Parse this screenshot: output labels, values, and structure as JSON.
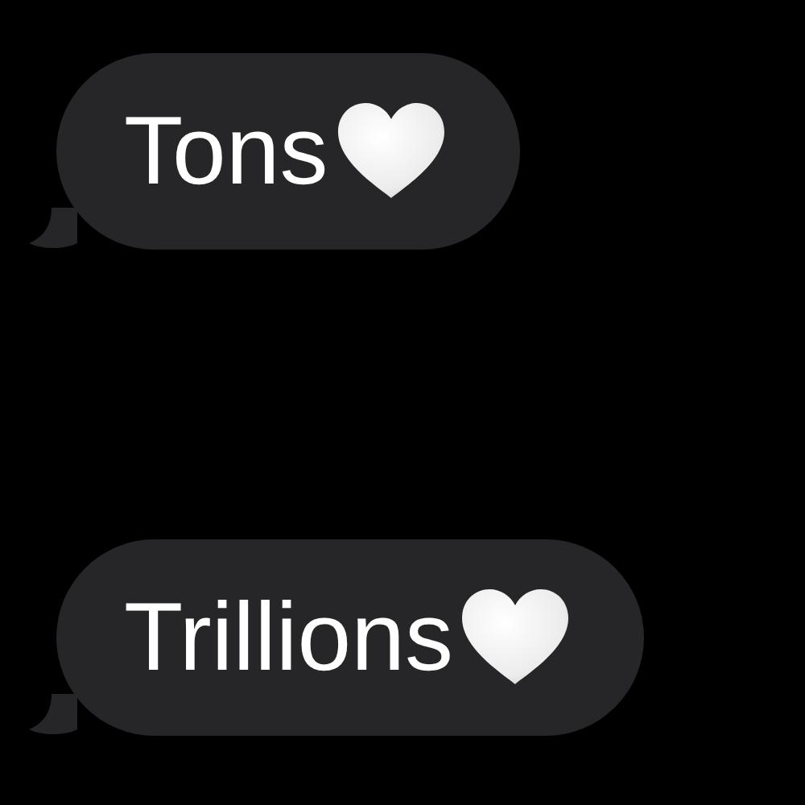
{
  "messages": [
    {
      "text": "Tons"
    },
    {
      "text": "Trillions"
    }
  ]
}
